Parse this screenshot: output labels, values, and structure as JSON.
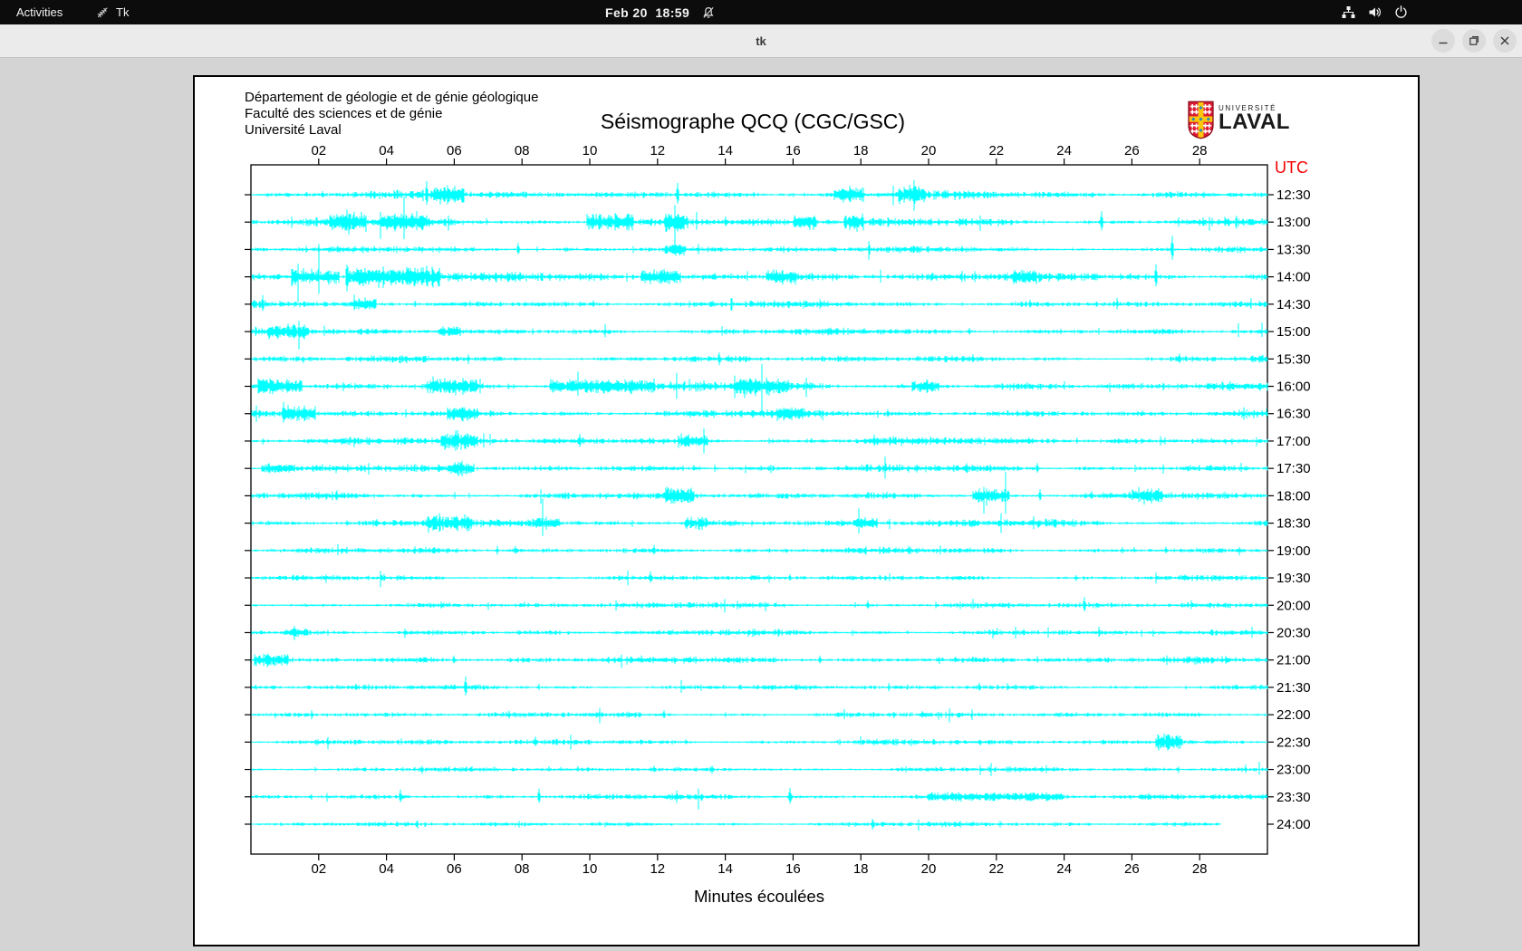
{
  "topbar": {
    "activities_label": "Activities",
    "app_menu_label": "Tk",
    "clock": "Feb 20  18:59"
  },
  "titlebar": {
    "title": "tk"
  },
  "window": {
    "header_lines": [
      "Département de géologie et de génie géologique",
      "Faculté des sciences et de génie",
      "Université Laval"
    ],
    "plot_title": "Séismographe QCQ (CGC/GSC)",
    "logo_top": "UNIVERSITÉ",
    "logo_bottom": "LAVAL",
    "utc_label": "UTC",
    "x_axis_label": "Minutes écoulées"
  },
  "colors": {
    "trace": "#00ffff",
    "utc_label": "#f40000",
    "axis": "#000000",
    "desktop": "#d4d4d4",
    "topbar_bg": "#0c0c0c",
    "titlebar_bg": "#ebebeb",
    "logo_red": "#da1a32",
    "logo_yellow": "#ffc60b",
    "logo_blue": "#1c8dc4"
  },
  "chart_data": {
    "type": "line",
    "title": "Séismographe QCQ (CGC/GSC)",
    "xlabel": "Minutes écoulées",
    "ylabel_right": "UTC",
    "x_range_minutes": [
      0,
      30
    ],
    "x_tick_minutes": [
      2,
      4,
      6,
      8,
      10,
      12,
      14,
      16,
      18,
      20,
      22,
      24,
      26,
      28
    ],
    "x_tick_labels": [
      "02",
      "04",
      "06",
      "08",
      "10",
      "12",
      "14",
      "16",
      "18",
      "20",
      "22",
      "24",
      "26",
      "28"
    ],
    "grid": false,
    "trace_color": "#00ffff",
    "rows": [
      {
        "time": "12:30",
        "base": 2.3,
        "bursts": [
          [
            5.4,
            6.3,
            5.5
          ],
          [
            17.2,
            18.1,
            4.5
          ],
          [
            19.1,
            19.9,
            5
          ]
        ],
        "spikes": [
          [
            5.2,
            15
          ],
          [
            12.6,
            13
          ],
          [
            2.1,
            4
          ]
        ]
      },
      {
        "time": "13:00",
        "base": 2.5,
        "bursts": [
          [
            2.3,
            3.4,
            5.5
          ],
          [
            3.8,
            5.2,
            4.5
          ],
          [
            9.9,
            11.3,
            5.5
          ],
          [
            12.2,
            12.9,
            6
          ],
          [
            16.0,
            16.7,
            4.5
          ],
          [
            17.5,
            18.1,
            4.5
          ]
        ],
        "spikes": [
          [
            12.5,
            9
          ],
          [
            25.1,
            12
          ],
          [
            14.0,
            6
          ]
        ]
      },
      {
        "time": "13:30",
        "base": 1.8,
        "bursts": [
          [
            12.2,
            12.8,
            3.5
          ]
        ],
        "spikes": [
          [
            7.9,
            7
          ],
          [
            27.2,
            15
          ],
          [
            21.0,
            4
          ]
        ]
      },
      {
        "time": "14:00",
        "base": 2.6,
        "bursts": [
          [
            1.2,
            2.6,
            5.5
          ],
          [
            2.8,
            5.6,
            6.5
          ],
          [
            11.5,
            12.7,
            5.5
          ],
          [
            15.2,
            16.1,
            4.5
          ],
          [
            22.5,
            23.2,
            3.5
          ]
        ],
        "spikes": [
          [
            4.6,
            11
          ],
          [
            15.5,
            8
          ],
          [
            26.7,
            14
          ],
          [
            12.2,
            7
          ]
        ]
      },
      {
        "time": "14:30",
        "base": 2.0,
        "bursts": [
          [
            3.0,
            3.7,
            3.5
          ]
        ],
        "spikes": [
          [
            0.35,
            10
          ],
          [
            23.0,
            5
          ],
          [
            10.1,
            4
          ]
        ]
      },
      {
        "time": "15:00",
        "base": 2.0,
        "bursts": [
          [
            0.5,
            1.7,
            3.5
          ],
          [
            5.5,
            6.2,
            3
          ]
        ],
        "spikes": [
          [
            21.2,
            4
          ]
        ]
      },
      {
        "time": "15:30",
        "base": 1.9,
        "bursts": [],
        "spikes": [
          [
            21.3,
            5
          ],
          [
            27.4,
            6
          ],
          [
            14.1,
            4
          ]
        ]
      },
      {
        "time": "16:00",
        "base": 2.4,
        "bursts": [
          [
            0.2,
            1.5,
            4.5
          ],
          [
            5.2,
            6.7,
            4.5
          ],
          [
            8.8,
            11.9,
            4.5
          ],
          [
            14.3,
            15.9,
            4.5
          ],
          [
            19.5,
            20.3,
            3.5
          ]
        ],
        "spikes": [
          [
            5.5,
            8
          ],
          [
            10.8,
            7
          ]
        ]
      },
      {
        "time": "16:30",
        "base": 2.3,
        "bursts": [
          [
            1.0,
            1.9,
            4.5
          ],
          [
            5.8,
            6.7,
            3.5
          ],
          [
            15.5,
            16.3,
            3.5
          ]
        ],
        "spikes": [
          [
            0.95,
            13
          ],
          [
            6.3,
            7
          ],
          [
            18.8,
            5
          ]
        ]
      },
      {
        "time": "17:00",
        "base": 2.2,
        "bursts": [
          [
            5.6,
            6.7,
            5
          ],
          [
            12.6,
            13.5,
            3.5
          ]
        ],
        "spikes": [
          [
            6.1,
            12
          ],
          [
            9.7,
            8
          ],
          [
            18.4,
            7
          ],
          [
            12.9,
            6
          ]
        ]
      },
      {
        "time": "17:30",
        "base": 2.2,
        "bursts": [
          [
            0.3,
            1.3,
            3.5
          ],
          [
            5.8,
            6.6,
            3.5
          ]
        ],
        "spikes": [
          [
            23.2,
            6
          ]
        ]
      },
      {
        "time": "18:00",
        "base": 2.1,
        "bursts": [
          [
            12.2,
            13.1,
            4.5
          ],
          [
            21.3,
            22.4,
            4.5
          ],
          [
            26.0,
            26.9,
            3.5
          ]
        ],
        "spikes": [
          [
            12.6,
            8
          ],
          [
            23.3,
            7
          ],
          [
            24.8,
            5
          ]
        ]
      },
      {
        "time": "18:30",
        "base": 2.2,
        "bursts": [
          [
            5.2,
            6.5,
            4.5
          ],
          [
            8.3,
            9.1,
            3.5
          ],
          [
            12.8,
            13.5,
            3.5
          ],
          [
            17.8,
            18.5,
            3.5
          ]
        ],
        "spikes": [
          [
            13.0,
            7
          ]
        ]
      },
      {
        "time": "19:00",
        "base": 1.8,
        "bursts": [],
        "spikes": [
          [
            7.8,
            5
          ],
          [
            11.9,
            6
          ],
          [
            19.4,
            5
          ],
          [
            27.0,
            4
          ]
        ]
      },
      {
        "time": "19:30",
        "base": 1.6,
        "bursts": [],
        "spikes": [
          [
            11.8,
            7
          ],
          [
            15.9,
            4
          ]
        ]
      },
      {
        "time": "20:00",
        "base": 1.7,
        "bursts": [],
        "spikes": [
          [
            18.2,
            5
          ],
          [
            24.6,
            9
          ]
        ]
      },
      {
        "time": "20:30",
        "base": 1.8,
        "bursts": [
          [
            1.0,
            1.7,
            2.5
          ]
        ],
        "spikes": [
          [
            22.8,
            4
          ]
        ]
      },
      {
        "time": "21:00",
        "base": 2.0,
        "bursts": [
          [
            0.1,
            1.1,
            4
          ]
        ],
        "spikes": [
          [
            6.0,
            5
          ],
          [
            16.8,
            5
          ]
        ]
      },
      {
        "time": "21:30",
        "base": 1.6,
        "bursts": [],
        "spikes": [
          [
            6.35,
            12
          ],
          [
            21.5,
            5
          ],
          [
            3.1,
            4
          ]
        ]
      },
      {
        "time": "22:00",
        "base": 1.6,
        "bursts": [],
        "spikes": [
          [
            12.2,
            5
          ],
          [
            19.8,
            4
          ]
        ]
      },
      {
        "time": "22:30",
        "base": 1.7,
        "bursts": [
          [
            26.7,
            27.5,
            5.5
          ]
        ],
        "spikes": [
          [
            8.4,
            6
          ]
        ]
      },
      {
        "time": "23:00",
        "base": 1.5,
        "bursts": [],
        "spikes": [
          [
            11.9,
            4
          ]
        ]
      },
      {
        "time": "23:30",
        "base": 1.7,
        "bursts": [
          [
            20.0,
            24.0,
            2.5
          ]
        ],
        "spikes": [
          [
            4.4,
            8
          ],
          [
            8.5,
            9
          ],
          [
            15.9,
            10
          ],
          [
            26.5,
            4
          ]
        ]
      },
      {
        "time": "24:00",
        "base": 1.5,
        "bursts": [],
        "spikes": [],
        "end_minute": 28.6
      }
    ]
  }
}
